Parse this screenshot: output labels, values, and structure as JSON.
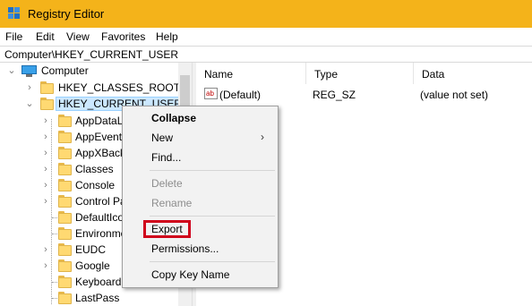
{
  "window": {
    "title": "Registry Editor"
  },
  "menubar": {
    "items": [
      "File",
      "Edit",
      "View",
      "Favorites",
      "Help"
    ]
  },
  "address": {
    "path": "Computer\\HKEY_CURRENT_USER"
  },
  "tree": {
    "root": "Computer",
    "hives": [
      "HKEY_CLASSES_ROOT",
      "HKEY_CURRENT_USER"
    ],
    "children": [
      "AppDataLow",
      "AppEvents",
      "AppXBackupContentType",
      "Classes",
      "Console",
      "Control Panel",
      "DefaultIcon",
      "Environment",
      "EUDC",
      "Google",
      "Keyboard Layout",
      "LastPass"
    ]
  },
  "list": {
    "columns": [
      "Name",
      "Type",
      "Data"
    ],
    "rows": [
      {
        "name": "(Default)",
        "type": "REG_SZ",
        "data": "(value not set)",
        "icon": "ab-string-icon"
      }
    ]
  },
  "context_menu": {
    "items": [
      {
        "label": "Collapse",
        "bold": true,
        "enabled": true
      },
      {
        "label": "New",
        "enabled": true,
        "submenu": true
      },
      {
        "label": "Find...",
        "enabled": true
      },
      {
        "label": "Delete",
        "enabled": false
      },
      {
        "label": "Rename",
        "enabled": false
      },
      {
        "label": "Export",
        "enabled": true,
        "highlighted": true
      },
      {
        "label": "Permissions...",
        "enabled": true
      },
      {
        "label": "Copy Key Name",
        "enabled": true
      }
    ],
    "submenu_arrow": "›",
    "highlight_color": "#d0021b"
  },
  "icons": {
    "expanded": "⌄",
    "collapsed": "›"
  },
  "colors": {
    "titlebar": "#f4b31a",
    "selection": "#cce8ff"
  }
}
